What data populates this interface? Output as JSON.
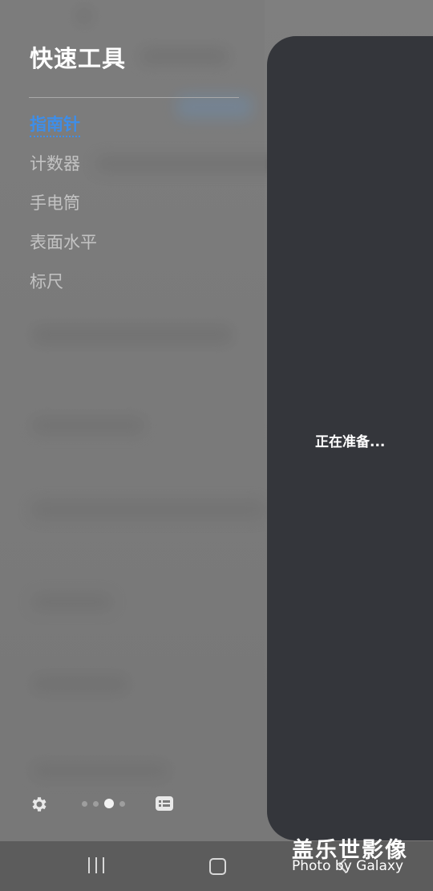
{
  "drawer": {
    "title": "快速工具",
    "items": [
      {
        "label": "指南针",
        "active": true
      },
      {
        "label": "计数器",
        "active": false
      },
      {
        "label": "手电筒",
        "active": false
      },
      {
        "label": "表面水平",
        "active": false
      },
      {
        "label": "标尺",
        "active": false
      }
    ],
    "page_indicator": {
      "pages": 4,
      "current": 3
    }
  },
  "panel": {
    "status_text": "正在准备..."
  },
  "watermark": {
    "line1": "盖乐世影像",
    "line2": "Photo by Galaxy"
  },
  "colors": {
    "accent": "#3e8ee9",
    "panel": "#34363b",
    "menu_text": "#c3c3c3"
  },
  "icons": {
    "settings": "gear-icon",
    "list": "list-icon",
    "recent": "recent-apps-icon",
    "home": "home-icon",
    "back": "back-icon"
  }
}
